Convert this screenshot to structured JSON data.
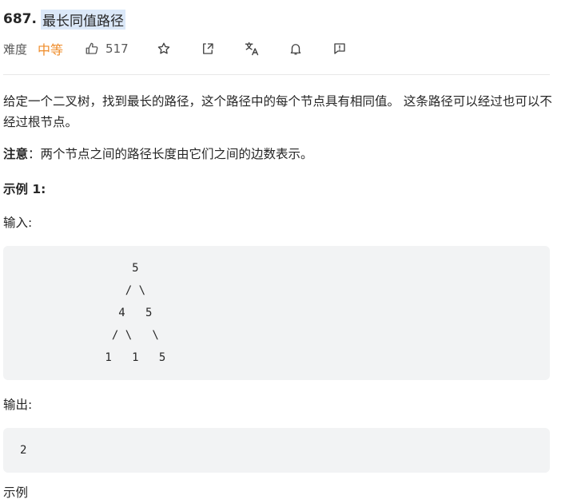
{
  "problem": {
    "number": "687.",
    "title": "最长同值路径",
    "difficulty_label": "难度",
    "difficulty": "中等",
    "likes": "517"
  },
  "toolbar_icons": [
    "thumbs-up-icon",
    "star-icon",
    "share-icon",
    "translate-icon",
    "bell-icon",
    "feedback-icon"
  ],
  "colors": {
    "difficulty": "#ef8c2a",
    "title_highlight": "#dbe8f8",
    "code_bg": "#f2f3f4"
  },
  "description": {
    "p1": "给定一个二叉树，找到最长的路径，这个路径中的每个节点具有相同值。 这条路径可以经过也可以不经过根节点。",
    "note_label": "注意",
    "note_text": "：两个节点之间的路径长度由它们之间的边数表示。"
  },
  "example": {
    "title": "示例 1:",
    "input_label": "输入:",
    "input_tree": "     5\n    / \\\n   4   5\n  / \\   \\\n 1   1   5",
    "output_label": "输出:",
    "output": "2",
    "next_label": "示例"
  }
}
